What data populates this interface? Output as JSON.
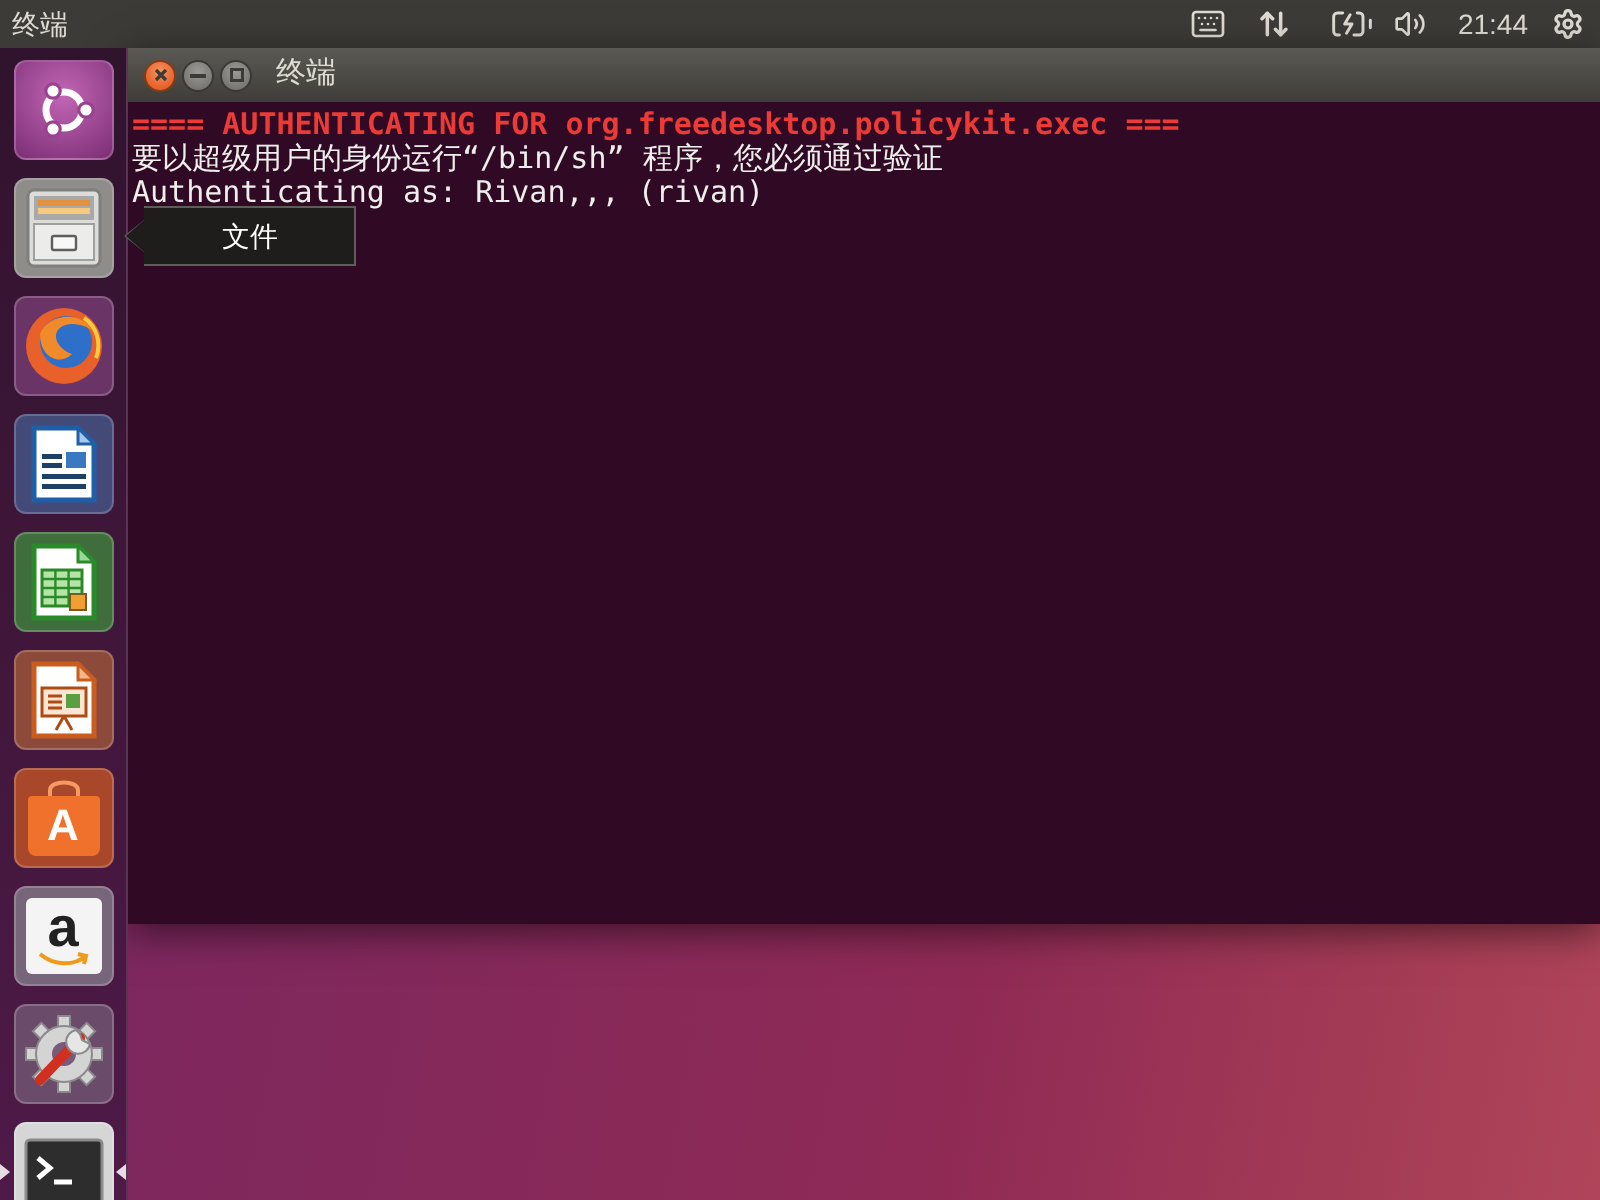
{
  "top_panel": {
    "app_title": "终端",
    "clock": "21:44"
  },
  "launcher": {
    "items": [
      {
        "kind": "dash",
        "running": false,
        "focused": false
      },
      {
        "kind": "files",
        "running": false,
        "focused": false,
        "tooltip": "文件"
      },
      {
        "kind": "browser",
        "running": false,
        "focused": false
      },
      {
        "kind": "writer",
        "running": false,
        "focused": false
      },
      {
        "kind": "calc",
        "running": false,
        "focused": false
      },
      {
        "kind": "impress",
        "running": false,
        "focused": false
      },
      {
        "kind": "store",
        "running": false,
        "focused": false,
        "glyph": "A"
      },
      {
        "kind": "amazon",
        "running": false,
        "focused": false,
        "glyph": "a"
      },
      {
        "kind": "settings",
        "running": false,
        "focused": false
      },
      {
        "kind": "terminal",
        "running": true,
        "focused": true
      }
    ]
  },
  "window": {
    "title": "终端",
    "lines": [
      {
        "kind": "alert",
        "text": "==== AUTHENTICATING FOR org.freedesktop.policykit.exec ==="
      },
      {
        "kind": "plain",
        "text": "要以超级用户的身份运行“/bin/sh” 程序，您必须通过验证"
      },
      {
        "kind": "plain",
        "text": "Authenticating as: Rivan,,, (rivan)"
      }
    ]
  }
}
